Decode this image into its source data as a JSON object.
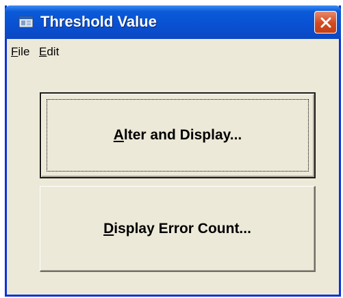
{
  "window": {
    "title": "Threshold Value",
    "icon": "app-window-icon",
    "close_icon": "close-icon"
  },
  "menu": {
    "file": {
      "accel": "F",
      "rest": "ile"
    },
    "edit": {
      "accel": "E",
      "rest": "dit"
    }
  },
  "buttons": {
    "alter_display": {
      "accel": "A",
      "rest": "lter and Display..."
    },
    "error_count": {
      "accel": "D",
      "rest": "isplay Error Count..."
    }
  },
  "colors": {
    "titlebar": "#0a5bd9",
    "window_face": "#ece9d8",
    "close_button": "#d3491f"
  }
}
